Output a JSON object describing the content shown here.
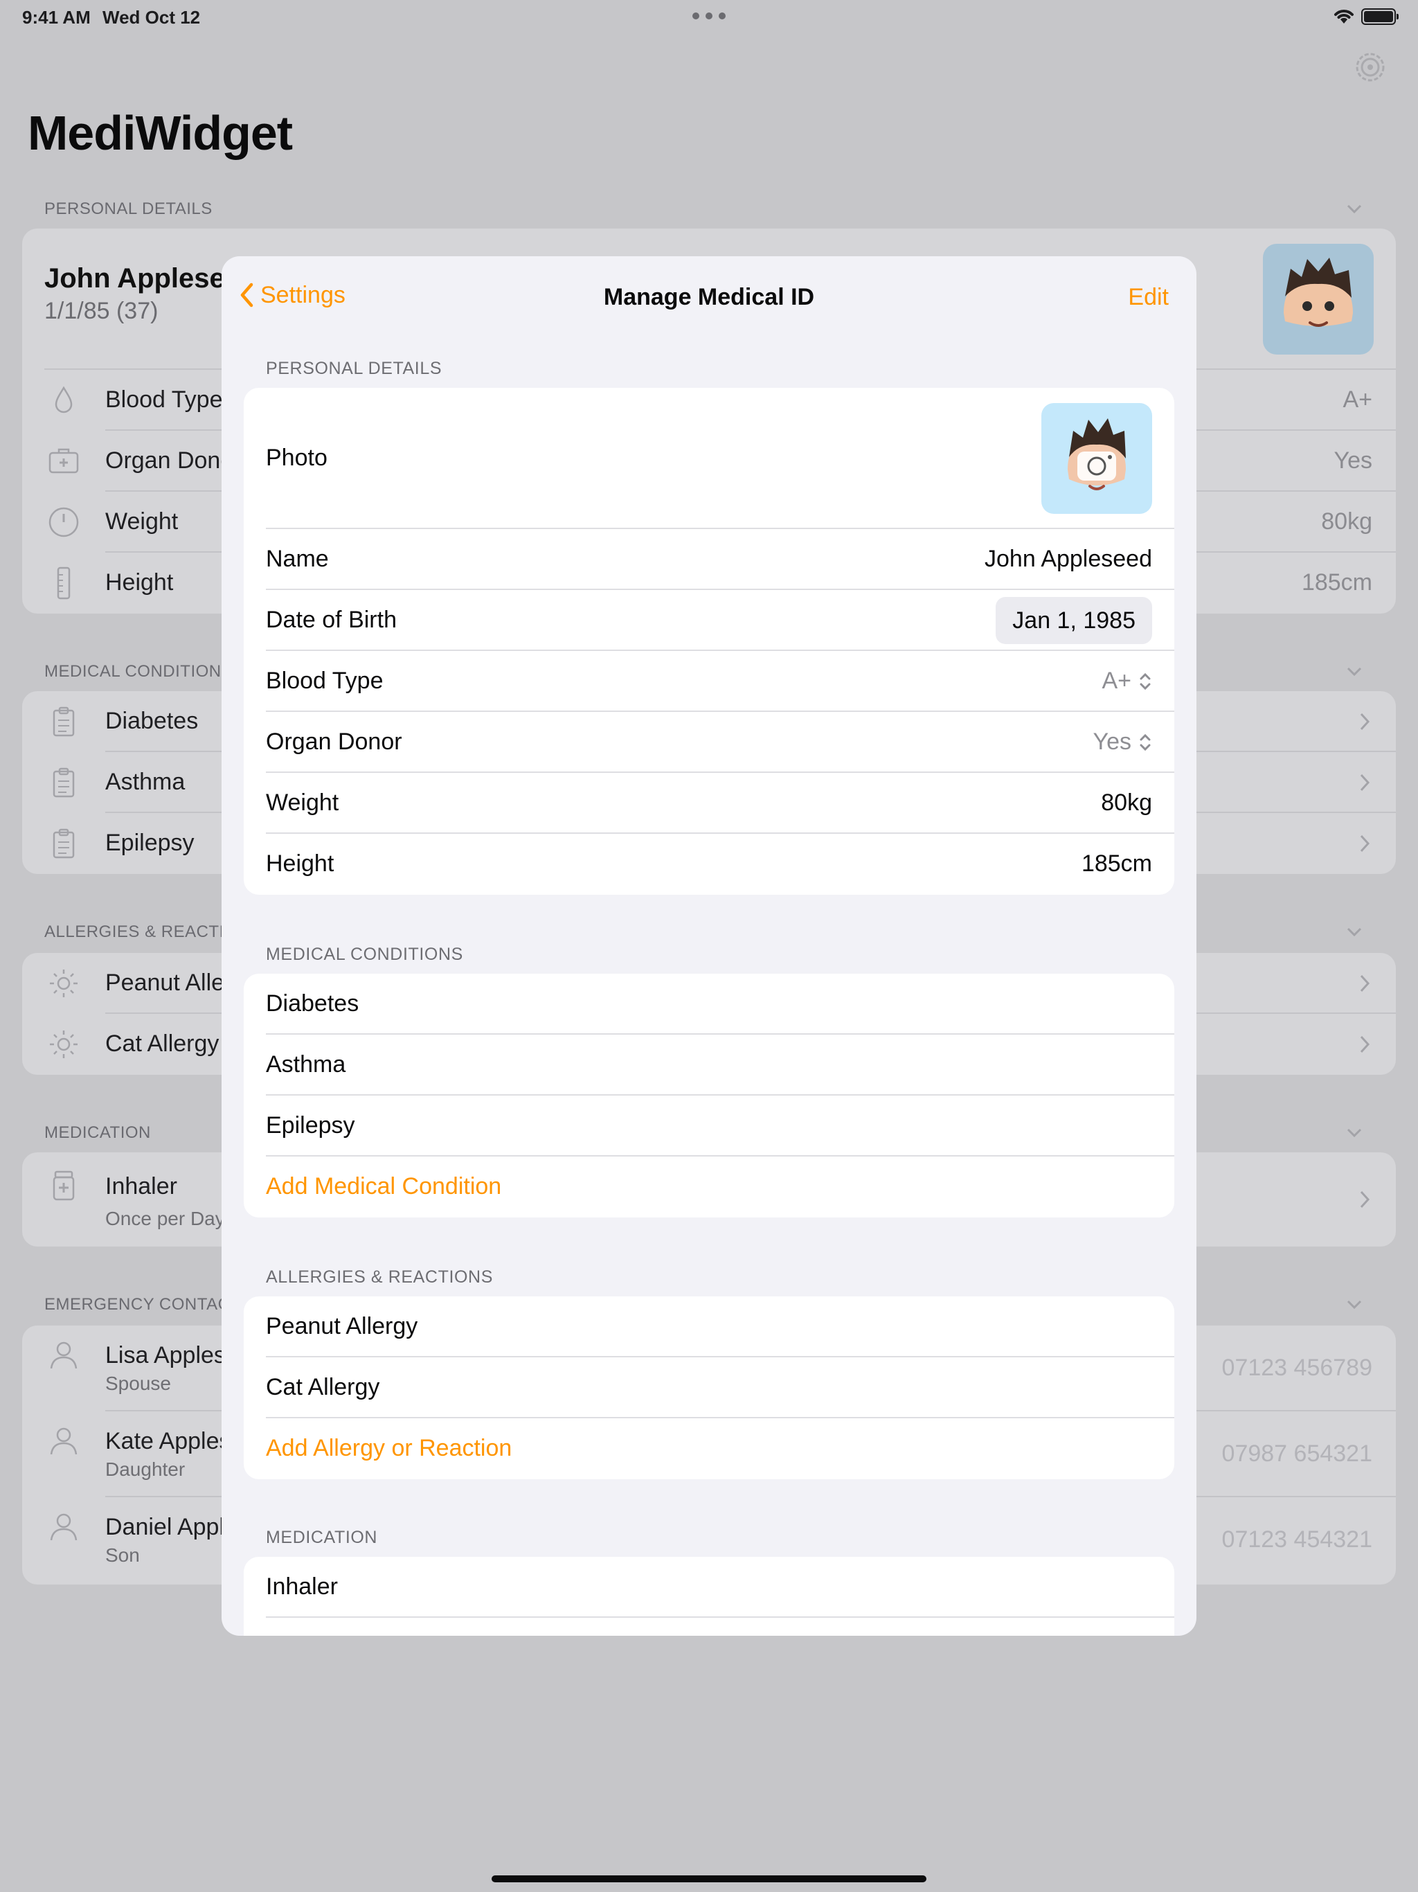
{
  "status_bar": {
    "time": "9:41 AM",
    "date": "Wed Oct 12"
  },
  "app": {
    "title": "MediWidget"
  },
  "background": {
    "personal": {
      "header": "PERSONAL DETAILS",
      "name": "John Appleseed",
      "dob": "1/1/85 (37)",
      "rows": [
        {
          "label": "Blood Type",
          "value": "A+",
          "icon": "drop-icon"
        },
        {
          "label": "Organ Donor",
          "value": "Yes",
          "icon": "medical-kit-icon"
        },
        {
          "label": "Weight",
          "value": "80kg",
          "icon": "scale-icon"
        },
        {
          "label": "Height",
          "value": "185cm",
          "icon": "ruler-icon"
        }
      ]
    },
    "conditions": {
      "header": "MEDICAL CONDITIONS",
      "items": [
        "Diabetes",
        "Asthma",
        "Epilepsy"
      ]
    },
    "allergies": {
      "header": "ALLERGIES & REACTIONS",
      "items": [
        "Peanut Allergy",
        "Cat Allergy"
      ]
    },
    "medication": {
      "header": "MEDICATION",
      "items": [
        {
          "label": "Inhaler",
          "sub": "Once per Day"
        }
      ]
    },
    "contacts": {
      "header": "EMERGENCY CONTACTS",
      "items": [
        {
          "name": "Lisa Appleseed",
          "relation": "Spouse",
          "phone": "07123 456789"
        },
        {
          "name": "Kate Appleseed",
          "relation": "Daughter",
          "phone": "07987 654321"
        },
        {
          "name": "Daniel Appleseed",
          "relation": "Son",
          "phone": "07123 454321"
        }
      ]
    }
  },
  "sheet": {
    "back_label": "Settings",
    "title": "Manage Medical ID",
    "edit_label": "Edit",
    "personal": {
      "header": "PERSONAL DETAILS",
      "photo_label": "Photo",
      "name_label": "Name",
      "name_value": "John Appleseed",
      "dob_label": "Date of Birth",
      "dob_value": "Jan 1, 1985",
      "blood_label": "Blood Type",
      "blood_value": "A+",
      "donor_label": "Organ Donor",
      "donor_value": "Yes",
      "weight_label": "Weight",
      "weight_value": "80kg",
      "height_label": "Height",
      "height_value": "185cm"
    },
    "conditions": {
      "header": "MEDICAL CONDITIONS",
      "items": [
        "Diabetes",
        "Asthma",
        "Epilepsy"
      ],
      "add_label": "Add Medical Condition"
    },
    "allergies": {
      "header": "ALLERGIES & REACTIONS",
      "items": [
        "Peanut Allergy",
        "Cat Allergy"
      ],
      "add_label": "Add Allergy or Reaction"
    },
    "medication": {
      "header": "MEDICATION",
      "items": [
        "Inhaler"
      ]
    }
  },
  "colors": {
    "accent": "#ff9500",
    "sheet_bg": "#f2f2f7",
    "dimmed_bg": "#c6c6c9"
  }
}
